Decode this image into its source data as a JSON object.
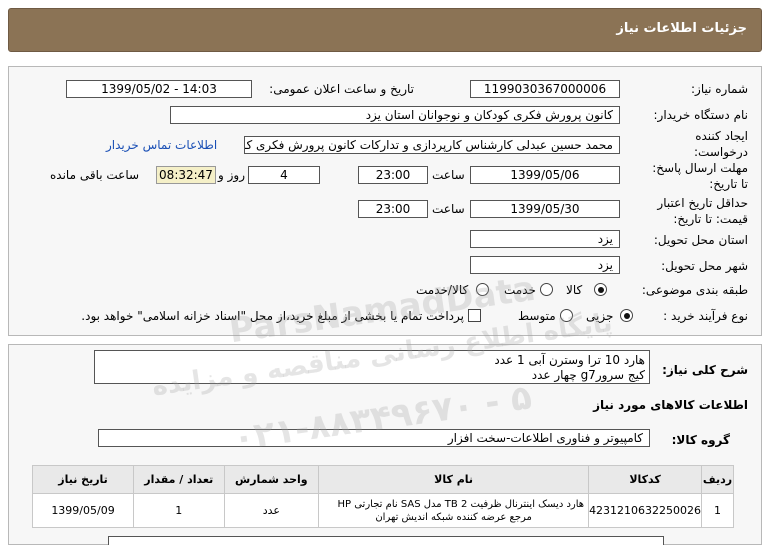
{
  "header": {
    "title": "جزئیات اطلاعات نیاز"
  },
  "form": {
    "need_number_label": "شماره نیاز:",
    "need_number": "1199030367000006",
    "announce_label": "تاریخ و ساعت اعلان عمومی:",
    "announce_value": "1399/05/02 - 14:03",
    "buyer_label": "نام دستگاه خریدار:",
    "buyer_value": "کانون پرورش فکری کودکان و نوجوانان استان یزد",
    "creator_label_1": "ایجاد کننده",
    "creator_label_2": "درخواست:",
    "creator_value": "محمد حسین عبدلی کارشناس کارپردازی و تدارکات کانون پرورش فکری کودکان",
    "contact_link": "اطلاعات تماس خریدار",
    "deadline_label_1": "مهلت ارسال پاسخ:",
    "deadline_label_2": "تا تاریخ:",
    "deadline_date": "1399/05/06",
    "time_label": "ساعت",
    "deadline_time": "23:00",
    "days_value": "4",
    "days_label": "روز و",
    "timer_value": "08:32:47",
    "remaining_label": "ساعت باقی مانده",
    "validity_label_1": "حداقل تاریخ اعتبار",
    "validity_label_2": "قیمت: تا تاریخ:",
    "validity_date": "1399/05/30",
    "validity_time": "23:00",
    "province_label": "استان محل تحویل:",
    "province_value": "یزد",
    "city_label": "شهر محل تحویل:",
    "city_value": "یزد",
    "category_label": "طبقه بندی موضوعی:",
    "category_options": [
      "کالا",
      "خدمت",
      "کالا/خدمت"
    ],
    "process_label": "نوع فرآیند خرید :",
    "process_options": [
      "جزیی",
      "متوسط"
    ],
    "payment_note": "پرداخت تمام یا بخشی از مبلغ خرید،از محل \"اسناد خزانه اسلامی\" خواهد بود."
  },
  "description": {
    "label": "شرح کلی نیاز:",
    "line1": "هارد 10 ترا وسترن آبی 1 عدد",
    "line2": "کیج سرورg7   چهار عدد"
  },
  "goods": {
    "section_title": "اطلاعات کالاهای مورد نیاز",
    "group_label": "گروه کالا:",
    "group_value": "کامپیوتر و فناوری اطلاعات-سخت افزار",
    "columns": [
      "ردیف",
      "کدکالا",
      "نام کالا",
      "واحد شمارش",
      "تعداد / مقدار",
      "تاریخ نیاز"
    ],
    "rows": [
      {
        "row": "1",
        "code": "4231210632250026",
        "name_line1": "هارد دیسک اینترنال ظرفیت 2 TB مدل SAS نام تجارتی HP",
        "name_line2": "مرجع عرضه کننده شبکه اندیش تهران",
        "unit": "عدد",
        "qty": "1",
        "date": "1399/05/09"
      }
    ]
  },
  "watermark": {
    "line1": "ParsNamadData",
    "line2": "پایگاه اطلاع رسانی مناقصه و مزایده",
    "line3": "۰۲۱-۸۸۳۴۹۶۷۰ - ۵"
  }
}
